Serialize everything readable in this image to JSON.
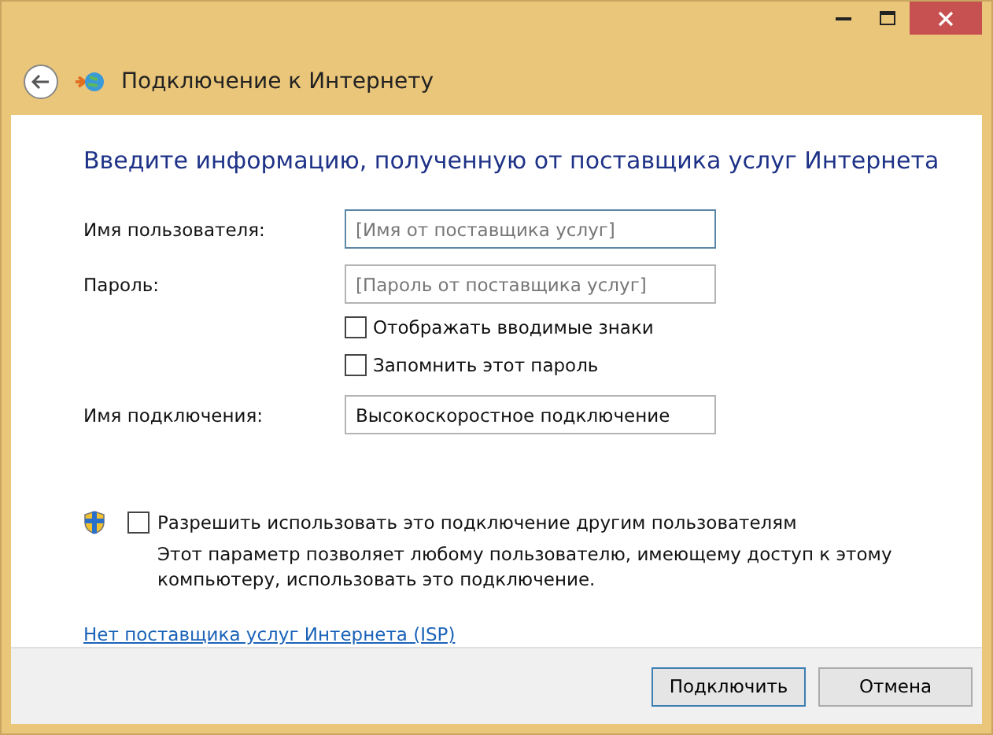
{
  "window": {
    "title": "Подключение к Интернету"
  },
  "heading": "Введите информацию, полученную от поставщика услуг Интернета",
  "fields": [
    {
      "label": "Имя пользователя:",
      "placeholder": "[Имя от поставщика услуг]",
      "focused": true
    },
    {
      "label": "Пароль:",
      "placeholder": "[Пароль от поставщика услуг]",
      "focused": false,
      "options": [
        {
          "label": "Отображать вводимые знаки",
          "checked": false
        },
        {
          "label": "Запомнить этот пароль",
          "checked": false
        }
      ]
    },
    {
      "label": "Имя подключения:",
      "value": "Высокоскоростное подключение",
      "focused": false
    }
  ],
  "share": {
    "label": "Разрешить использовать это подключение другим пользователям",
    "checked": false,
    "description": "Этот параметр позволяет любому пользователю, имеющему доступ к этому компьютеру, использовать это подключение."
  },
  "link": "Нет поставщика услуг Интернета (ISP)",
  "buttons": [
    {
      "label": "Подключить",
      "default": true
    },
    {
      "label": "Отмена",
      "default": false
    }
  ]
}
